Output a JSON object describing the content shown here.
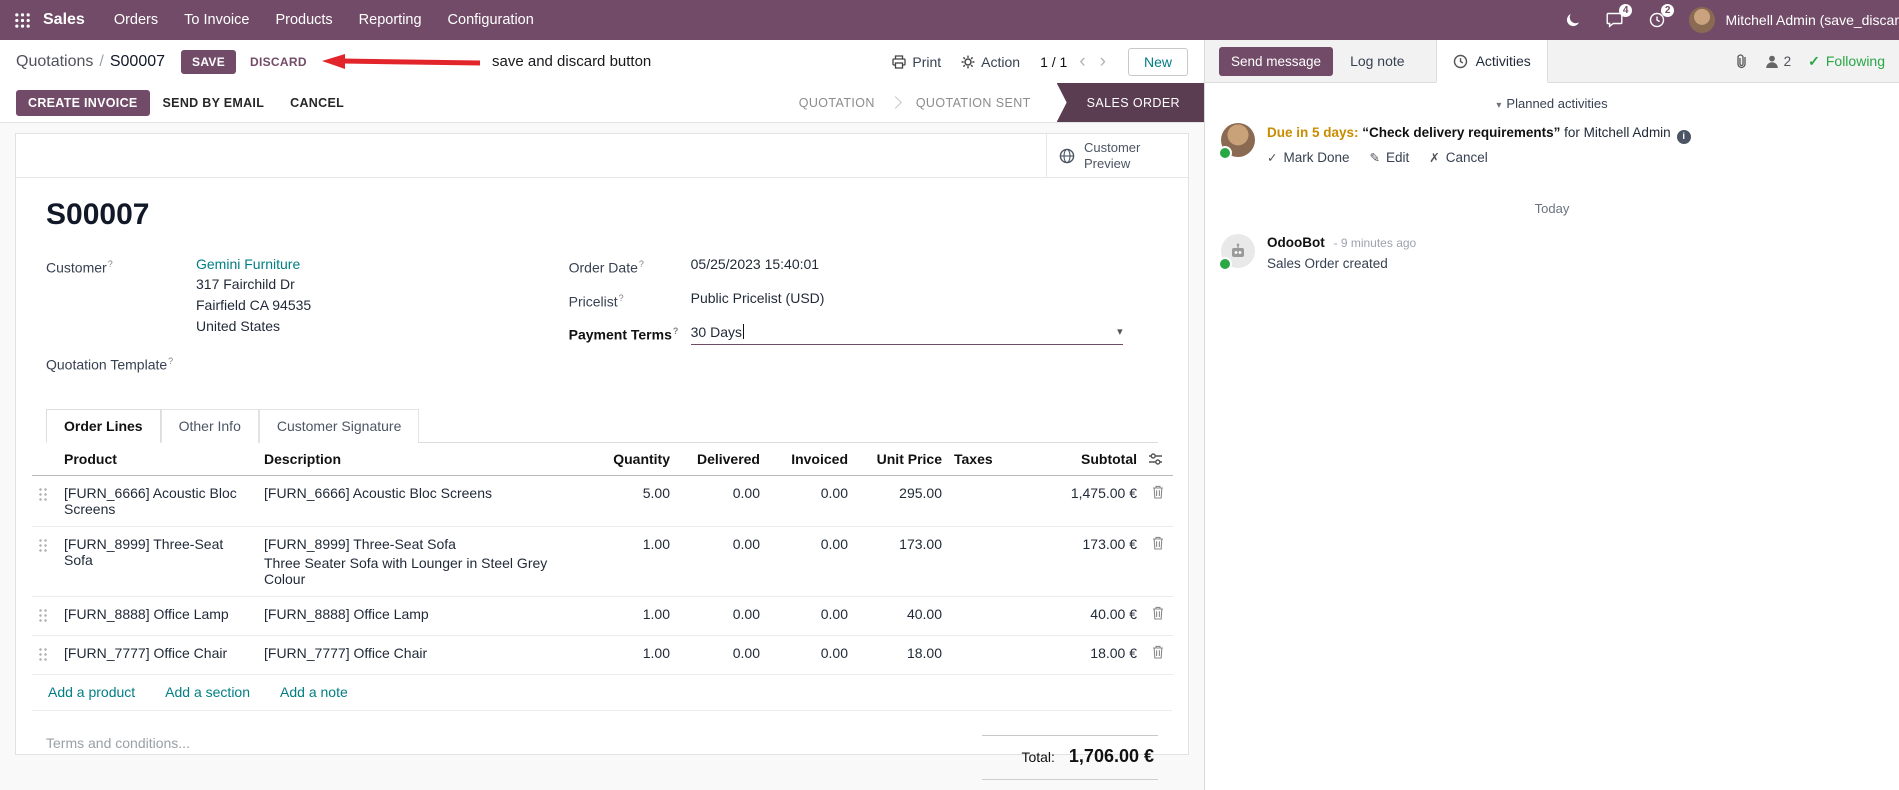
{
  "colors": {
    "brand": "#714B67",
    "link": "#017E84",
    "edited": "#2E75B6",
    "arrow": "#E2252B",
    "warning": "#C98B00",
    "success": "#28A745",
    "status-active": "#5B3D52"
  },
  "icons": {
    "caret_down": "▾",
    "chevron_left": "‹",
    "chevron_right": "›",
    "check": "✓",
    "pencil": "✎",
    "cross": "✗",
    "info_letter": "i"
  },
  "topbar": {
    "app_name": "Sales",
    "menus": [
      "Orders",
      "To Invoice",
      "Products",
      "Reporting",
      "Configuration"
    ],
    "messages_badge": "4",
    "activities_badge": "2",
    "user_name": "Mitchell Admin (save_discar"
  },
  "control_panel": {
    "breadcrumb_parent": "Quotations",
    "breadcrumb_sep": "/",
    "breadcrumb_current": "S00007",
    "save": "SAVE",
    "discard": "DISCARD",
    "print": "Print",
    "action": "Action",
    "pager": "1 / 1",
    "new": "New"
  },
  "annotation": {
    "text": "save and discard button"
  },
  "statusbar": {
    "create_invoice": "CREATE INVOICE",
    "send_by_email": "SEND BY EMAIL",
    "cancel": "CANCEL",
    "states": [
      "QUOTATION",
      "QUOTATION SENT",
      "SALES ORDER"
    ],
    "active_state": "SALES ORDER"
  },
  "sheet": {
    "customer_preview": "Customer Preview",
    "title": "S00007",
    "help_marker": "?",
    "customer_label": "Customer",
    "customer_name": "Gemini Furniture",
    "address": [
      "317 Fairchild Dr",
      "Fairfield CA 94535",
      "United States"
    ],
    "quotation_template_label": "Quotation Template",
    "order_date_label": "Order Date",
    "order_date": "05/25/2023 15:40:01",
    "pricelist_label": "Pricelist",
    "pricelist": "Public Pricelist (USD)",
    "payment_terms_label": "Payment Terms",
    "payment_terms": "30 Days",
    "tabs": [
      "Order Lines",
      "Other Info",
      "Customer Signature"
    ],
    "table": {
      "headers": [
        "Product",
        "Description",
        "Quantity",
        "Delivered",
        "Invoiced",
        "Unit Price",
        "Taxes",
        "Subtotal"
      ],
      "rows": [
        {
          "product": "[FURN_6666] Acoustic Bloc Screens",
          "description": "[FURN_6666] Acoustic Bloc Screens",
          "description2": "",
          "quantity": "5.00",
          "delivered": "0.00",
          "invoiced": "0.00",
          "unit_price": "295.00",
          "taxes": "",
          "subtotal": "1,475.00 €"
        },
        {
          "product": "[FURN_8999] Three-Seat Sofa",
          "description": "[FURN_8999] Three-Seat Sofa",
          "description2": "Three Seater Sofa with Lounger in Steel Grey Colour",
          "quantity": "1.00",
          "delivered": "0.00",
          "invoiced": "0.00",
          "unit_price": "173.00",
          "taxes": "",
          "subtotal": "173.00 €"
        },
        {
          "product": "[FURN_8888] Office Lamp",
          "description": "[FURN_8888] Office Lamp",
          "description2": "",
          "quantity": "1.00",
          "delivered": "0.00",
          "invoiced": "0.00",
          "unit_price": "40.00",
          "taxes": "",
          "subtotal": "40.00 €"
        },
        {
          "product": "[FURN_7777] Office Chair",
          "description": "[FURN_7777] Office Chair",
          "description2": "",
          "quantity": "1.00",
          "delivered": "0.00",
          "invoiced": "0.00",
          "unit_price": "18.00",
          "taxes": "",
          "subtotal": "18.00 €"
        }
      ],
      "add_product": "Add a product",
      "add_section": "Add a section",
      "add_note": "Add a note"
    },
    "terms_placeholder": "Terms and conditions...",
    "total_label": "Total:",
    "total_value": "1,706.00 €"
  },
  "chatter": {
    "send_message": "Send message",
    "log_note": "Log note",
    "activities": "Activities",
    "followers_count": "2",
    "following": "Following",
    "planned_activities": "Planned activities",
    "activity": {
      "due": "Due in 5 days:",
      "summary": "“Check delivery requirements”",
      "assignee": "for Mitchell Admin",
      "mark_done": "Mark Done",
      "edit": "Edit",
      "cancel": "Cancel"
    },
    "date_divider": "Today",
    "message": {
      "author": "OdooBot",
      "time": "- 9 minutes ago",
      "body": "Sales Order created"
    }
  }
}
